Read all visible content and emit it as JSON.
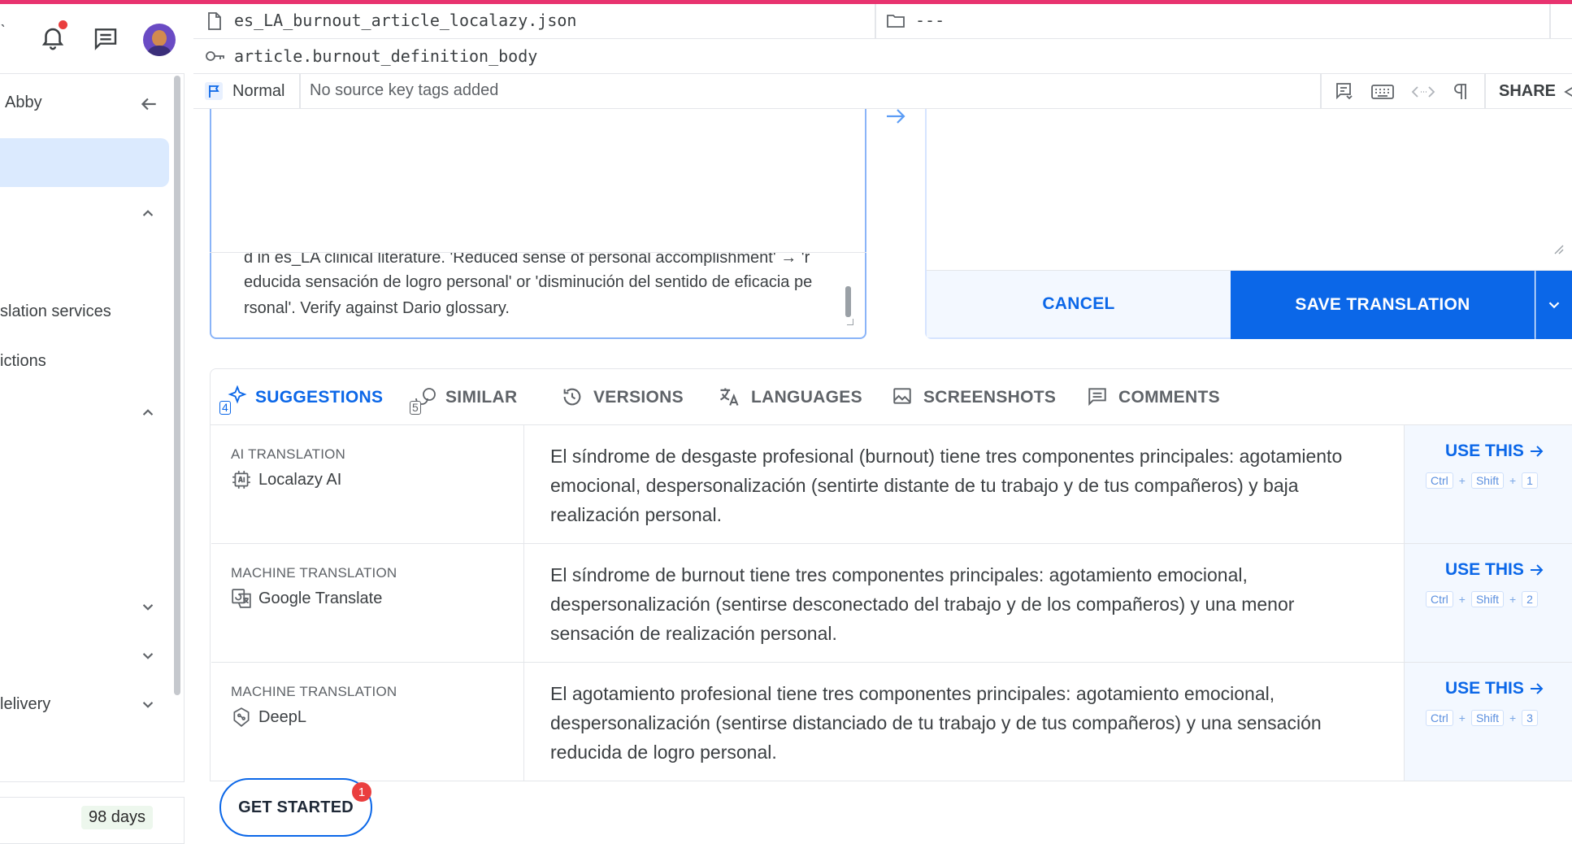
{
  "app": {
    "accent_color": "#0b67e8",
    "top_line_color": "#e8336f"
  },
  "sidebar": {
    "notification_dot_color": "#ea3e3e",
    "user_name": "Abby",
    "items": [
      {
        "label": "slation services"
      },
      {
        "label": "ictions"
      },
      {
        "label": "lelivery"
      }
    ],
    "trial_days": "98 days"
  },
  "header": {
    "file_name": "es_LA_burnout_article_localazy.json",
    "folder_path": "---",
    "source_key": "article.burnout_definition_body",
    "key_type": "Normal",
    "key_tags": "No source key tags added",
    "share_label": "SHARE"
  },
  "source_note": {
    "line_partial": "d in es_LA clinical literature. 'Reduced sense of personal accomplishment' → 'r",
    "line_1": "educida sensación de logro personal' or 'disminución del sentido de eficacia pe",
    "line_2": "rsonal'. Verify against Dario glossary."
  },
  "target_actions": {
    "cancel_label": "CANCEL",
    "save_label": "SAVE TRANSLATION"
  },
  "tabs": [
    {
      "label": "SUGGESTIONS",
      "count": "4",
      "icon": "sparkle-icon",
      "active": true
    },
    {
      "label": "SIMILAR",
      "count": "5",
      "icon": "similar-icon",
      "active": false
    },
    {
      "label": "VERSIONS",
      "icon": "history-icon",
      "active": false
    },
    {
      "label": "LANGUAGES",
      "icon": "translate-icon",
      "active": false
    },
    {
      "label": "SCREENSHOTS",
      "icon": "image-icon",
      "active": false
    },
    {
      "label": "COMMENTS",
      "icon": "comment-icon",
      "active": false
    }
  ],
  "suggestions": [
    {
      "kind": "AI TRANSLATION",
      "provider": "Localazy AI",
      "provider_icon": "ai-chip-icon",
      "text": "El síndrome de desgaste profesional (burnout) tiene tres componentes principales: agotamiento emocional, despersonalización (sentirte distante de tu trabajo y de tus compañeros) y baja realización personal.",
      "use_label": "USE THIS",
      "shortcut": [
        "Ctrl",
        "+",
        "Shift",
        "+",
        "1"
      ]
    },
    {
      "kind": "MACHINE TRANSLATION",
      "provider": "Google Translate",
      "provider_icon": "google-translate-icon",
      "text": "El síndrome de burnout tiene tres componentes principales: agotamiento emocional, despersonalización (sentirse desconectado del trabajo y de los compañeros) y una menor sensación de realización personal.",
      "use_label": "USE THIS",
      "shortcut": [
        "Ctrl",
        "+",
        "Shift",
        "+",
        "2"
      ]
    },
    {
      "kind": "MACHINE TRANSLATION",
      "provider": "DeepL",
      "provider_icon": "deepl-icon",
      "text": "El agotamiento profesional tiene tres componentes principales: agotamiento emocional, despersonalización (sentirse distanciado de tu trabajo y de tus compañeros) y una sensación reducida de logro personal.",
      "use_label": "USE THIS",
      "shortcut": [
        "Ctrl",
        "+",
        "Shift",
        "+",
        "3"
      ]
    }
  ],
  "onboarding": {
    "get_started_label": "GET STARTED",
    "badge_count": "1"
  }
}
